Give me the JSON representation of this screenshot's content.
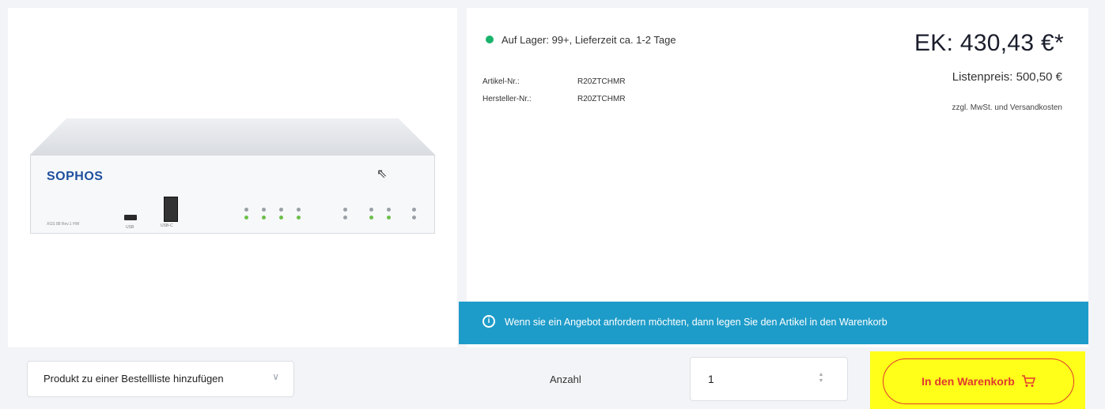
{
  "product": {
    "brand_label": "SOPHOS",
    "model_label": "XGS 88 Rev.1 HW",
    "usb_label": "USB",
    "console_label": "USB-C"
  },
  "stock": {
    "text": "Auf Lager: 99+, Lieferzeit ca. 1-2 Tage",
    "color": "#19b36b"
  },
  "details": {
    "article_label": "Artikel-Nr.:",
    "article_value": "R20ZTCHMR",
    "manufacturer_label": "Hersteller-Nr.:",
    "manufacturer_value": "R20ZTCHMR"
  },
  "pricing": {
    "price": "EK: 430,43 €*",
    "list_price": "Listenpreis: 500,50 €",
    "tax_note": "zzgl. MwSt. und Versandkosten"
  },
  "info_banner": {
    "text": "Wenn sie ein Angebot anfordern möchten, dann legen Sie den Artikel in den Warenkorb",
    "background": "#1e9cc9"
  },
  "actions": {
    "wishlist_select": "Produkt zu einer Bestellliste hinzufügen",
    "quantity_label": "Anzahl",
    "quantity_value": "1",
    "add_to_cart": "In den Warenkorb",
    "accent": "#e03a2f",
    "highlight": "#ffff19"
  },
  "icons": {
    "stock": "status-dot-icon",
    "info": "info-circle-icon",
    "chevron": "chevron-down-icon",
    "cart": "cart-icon",
    "cursor": "mouse-cursor-icon"
  }
}
